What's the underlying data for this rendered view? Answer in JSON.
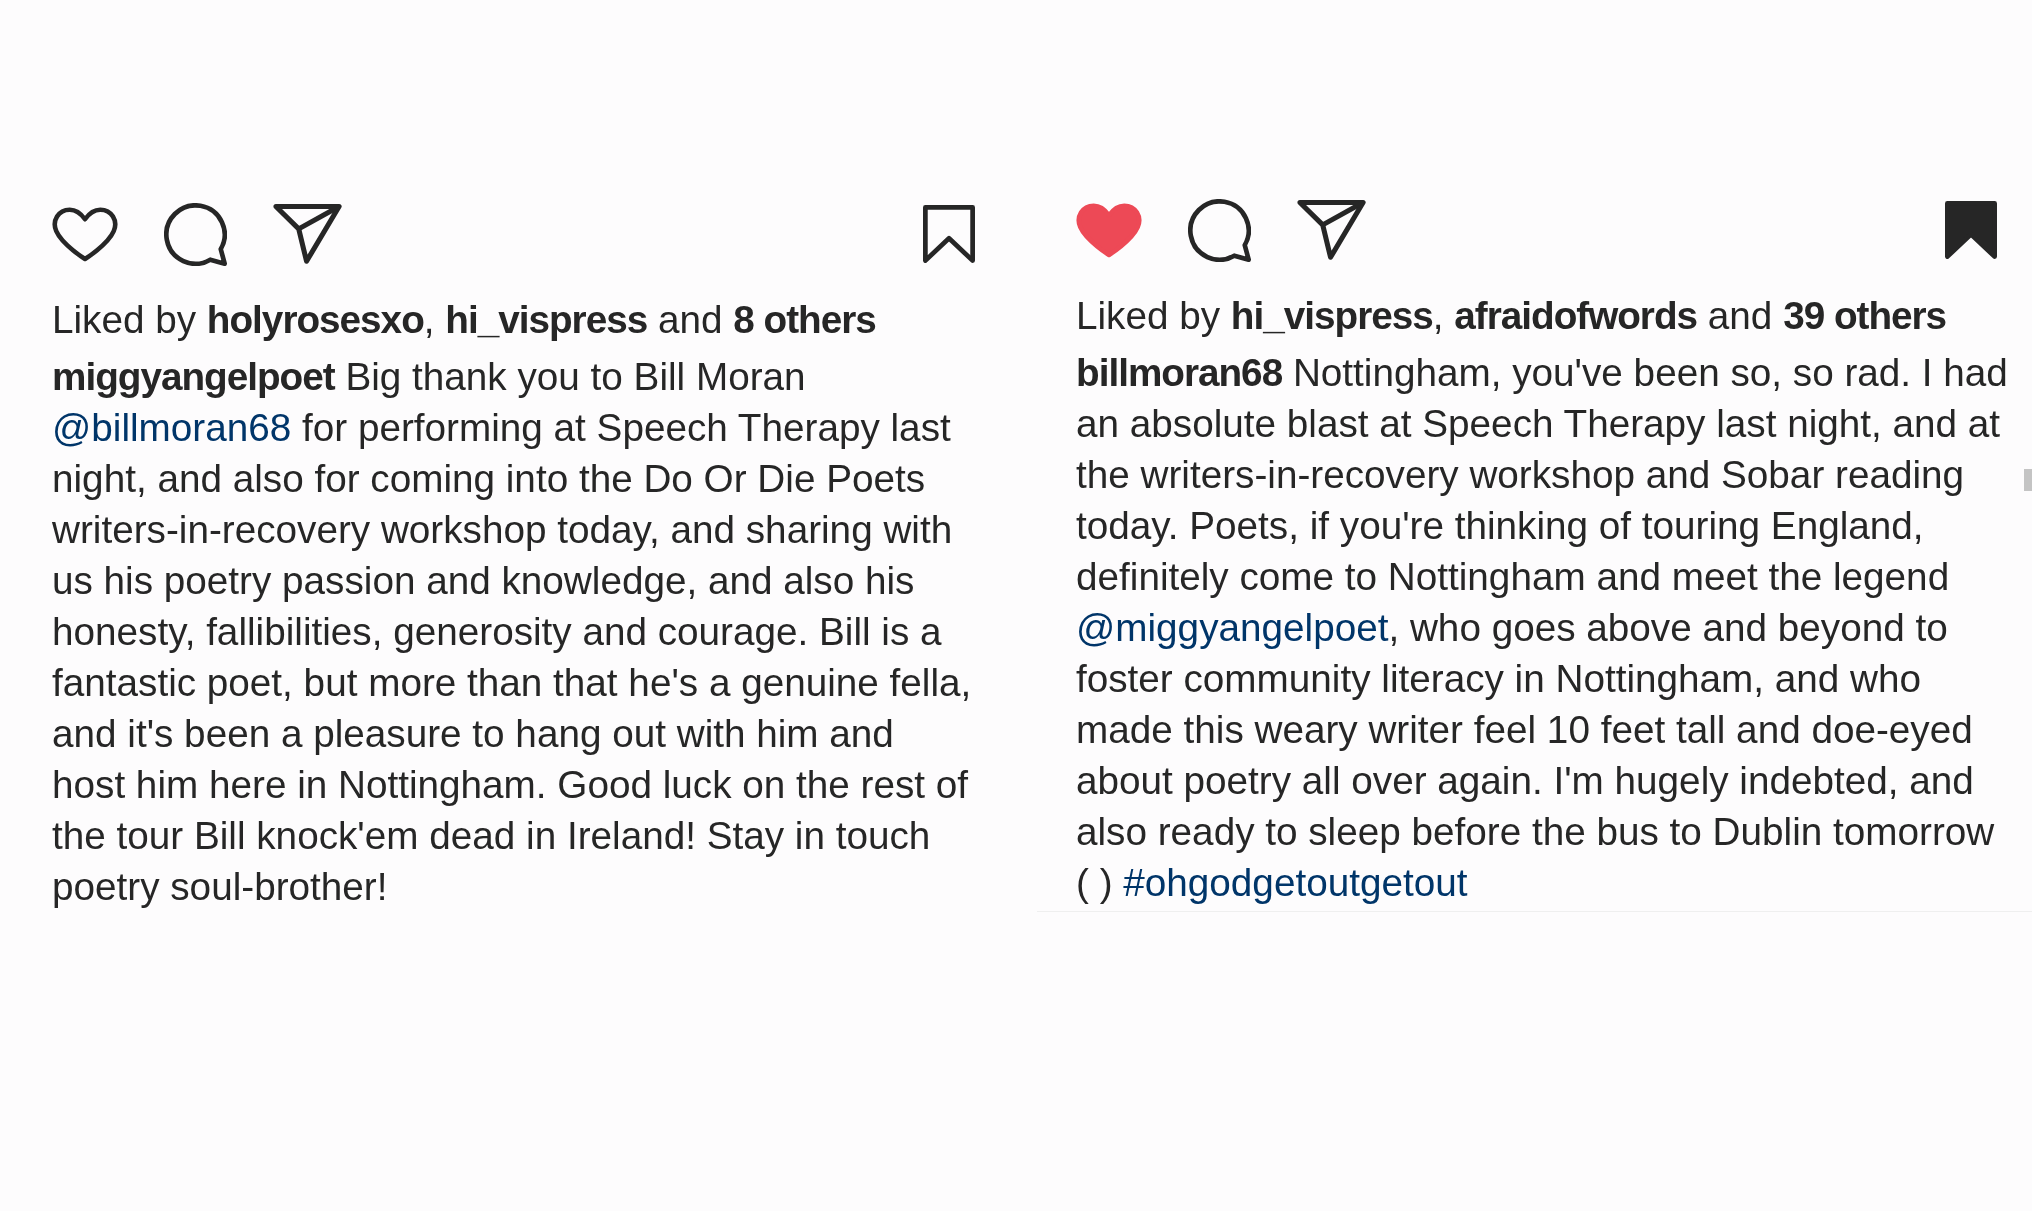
{
  "posts": [
    {
      "liked": false,
      "saved": false,
      "likes": "Liked by **holyrosesxo**, **hi_vispress** and **8 others**",
      "caption": [
        {
          "kind": "username",
          "text": "miggyangelpoet"
        },
        {
          "kind": "text",
          "text": " Big thank you to Bill Moran "
        },
        {
          "kind": "mention",
          "text": "@billmoran68"
        },
        {
          "kind": "text",
          "text": " for performing at Speech Therapy last night, and also for coming into the Do Or Die Poets writers-in-recovery workshop today, and sharing with us his poetry passion and knowledge, and also his honesty, fallibilities, generosity and courage. Bill is a fantastic poet, but more than that he's a genuine fella, and it's been a pleasure to hang out with him and host him here in Nottingham. Good luck on the rest of the tour Bill knock'em dead in Ireland! Stay in touch poetry soul-brother!"
        }
      ]
    },
    {
      "liked": true,
      "saved": true,
      "likes": "Liked by **hi_vispress**, **afraidofwords** and **39 others**",
      "caption": [
        {
          "kind": "username",
          "text": "billmoran68"
        },
        {
          "kind": "text",
          "text": " Nottingham, you've been so, so rad. I had an absolute blast at Speech Therapy last night, and at the writers-in-recovery workshop and Sobar reading today. Poets, if you're thinking of touring England, definitely come to Nottingham and meet the legend "
        },
        {
          "kind": "mention",
          "text": "@miggyangelpoet"
        },
        {
          "kind": "text",
          "text": ", who goes above and beyond to foster community literacy in Nottingham, and who made this weary writer feel 10 feet tall and doe-eyed about poetry all over again. I'm hugely indebted, and also ready to sleep before the bus to Dublin tomorrow ( ) "
        },
        {
          "kind": "hashtag",
          "text": "#ohgodgetoutgetout"
        }
      ]
    }
  ]
}
